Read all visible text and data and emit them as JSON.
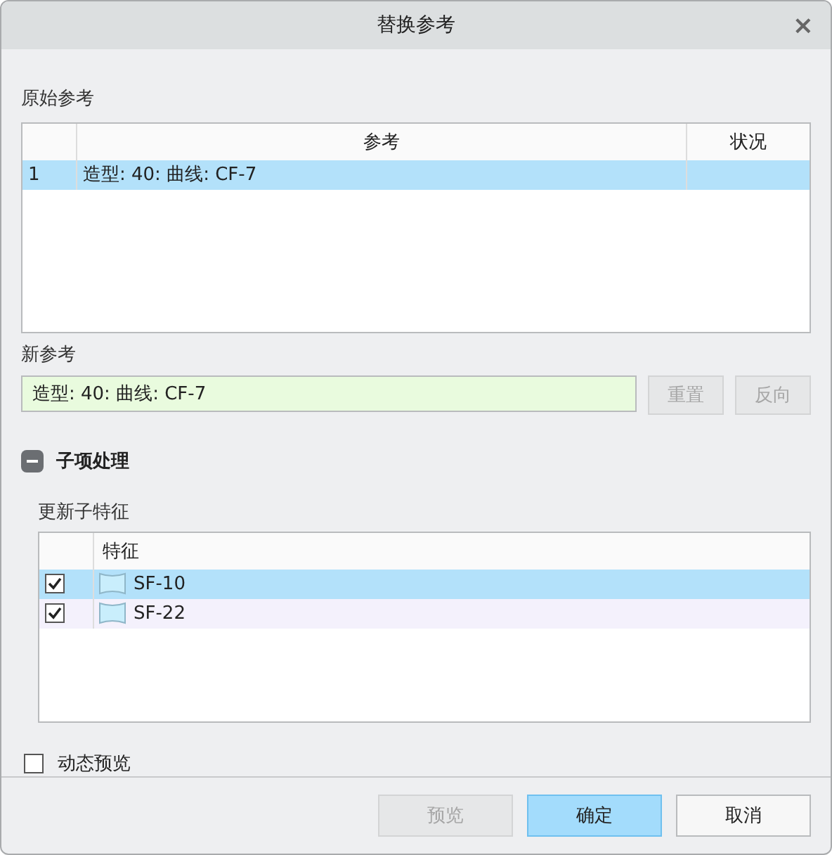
{
  "window": {
    "title": "替换参考",
    "close": "×"
  },
  "original_refs": {
    "label": "原始参考",
    "columns": [
      "参考",
      "状况"
    ],
    "rows": [
      {
        "index": "1",
        "reference": "造型: 40: 曲线: CF-7",
        "selected": true
      }
    ]
  },
  "new_ref": {
    "label": "新参考",
    "value": "造型: 40: 曲线: CF-7",
    "buttons": [
      {
        "label": "重置",
        "disabled": true
      },
      {
        "label": "反向",
        "disabled": true
      }
    ]
  },
  "children_section": {
    "title": "子项处理",
    "expanded": true,
    "sublabel": "更新子特征",
    "columns": [
      "特征"
    ],
    "rows": [
      {
        "name": "SF-10",
        "checked": true,
        "selected": true
      },
      {
        "name": "SF-22",
        "checked": true,
        "selected": false
      }
    ]
  },
  "dynamic_preview": {
    "label": "动态预览",
    "checked": false
  },
  "buttons": [
    {
      "label": "预览",
      "kind": "disabled"
    },
    {
      "label": "确定",
      "kind": "primary"
    },
    {
      "label": "取消",
      "kind": "normal"
    }
  ]
}
